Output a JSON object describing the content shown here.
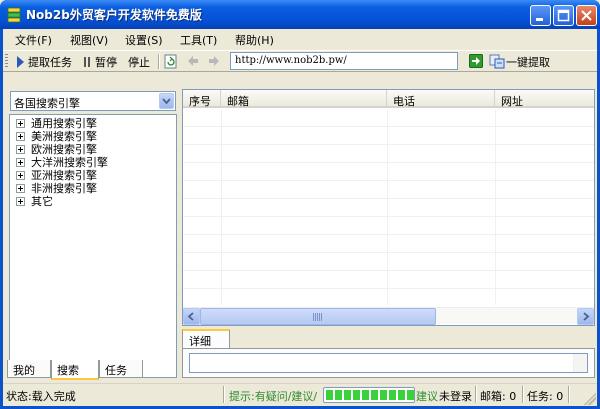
{
  "window": {
    "title": "Nob2b外贸客户开发软件免费版",
    "controls": [
      "minimize-icon",
      "maximize-icon",
      "close-icon"
    ]
  },
  "menu": {
    "items": [
      {
        "label": "文件(F)"
      },
      {
        "label": "视图(V)"
      },
      {
        "label": "设置(S)"
      },
      {
        "label": "工具(T)"
      },
      {
        "label": "帮助(H)"
      }
    ]
  },
  "toolbar": {
    "start_label": "提取任务",
    "pause_label": "暂停",
    "stop_label": "停止",
    "url_value": "http://www.nob2b.pw/",
    "one_click_label": "一键提取"
  },
  "left": {
    "engine_select": "各国搜索引擎",
    "tree": [
      {
        "label": "通用搜索引擎"
      },
      {
        "label": "美洲搜索引擎"
      },
      {
        "label": "欧洲搜索引擎"
      },
      {
        "label": "大洋洲搜索引擎"
      },
      {
        "label": "亚洲搜索引擎"
      },
      {
        "label": "非洲搜索引擎"
      },
      {
        "label": "其它"
      }
    ],
    "tabs": [
      {
        "label": "我的",
        "active": false
      },
      {
        "label": "搜索",
        "active": true
      },
      {
        "label": "任务",
        "active": false
      }
    ]
  },
  "grid": {
    "columns": [
      "序号",
      "邮箱",
      "电话",
      "网址"
    ],
    "rows": []
  },
  "details": {
    "tab_label": "详细",
    "content": ""
  },
  "status": {
    "state": "状态:载入完成",
    "hint_prefix": "提示:有疑问/建议/",
    "hint_suffix": "建议",
    "login": "未登录",
    "mail_count": "邮箱: 0",
    "task_count": "任务: 0",
    "progress": 1.0,
    "hint_color": "#2e8b2e",
    "progress_color": "#3ad13a"
  },
  "colors": {
    "titlebar": "#0551d6",
    "face": "#ece9d8",
    "accent_tab": "#ffc83c"
  }
}
